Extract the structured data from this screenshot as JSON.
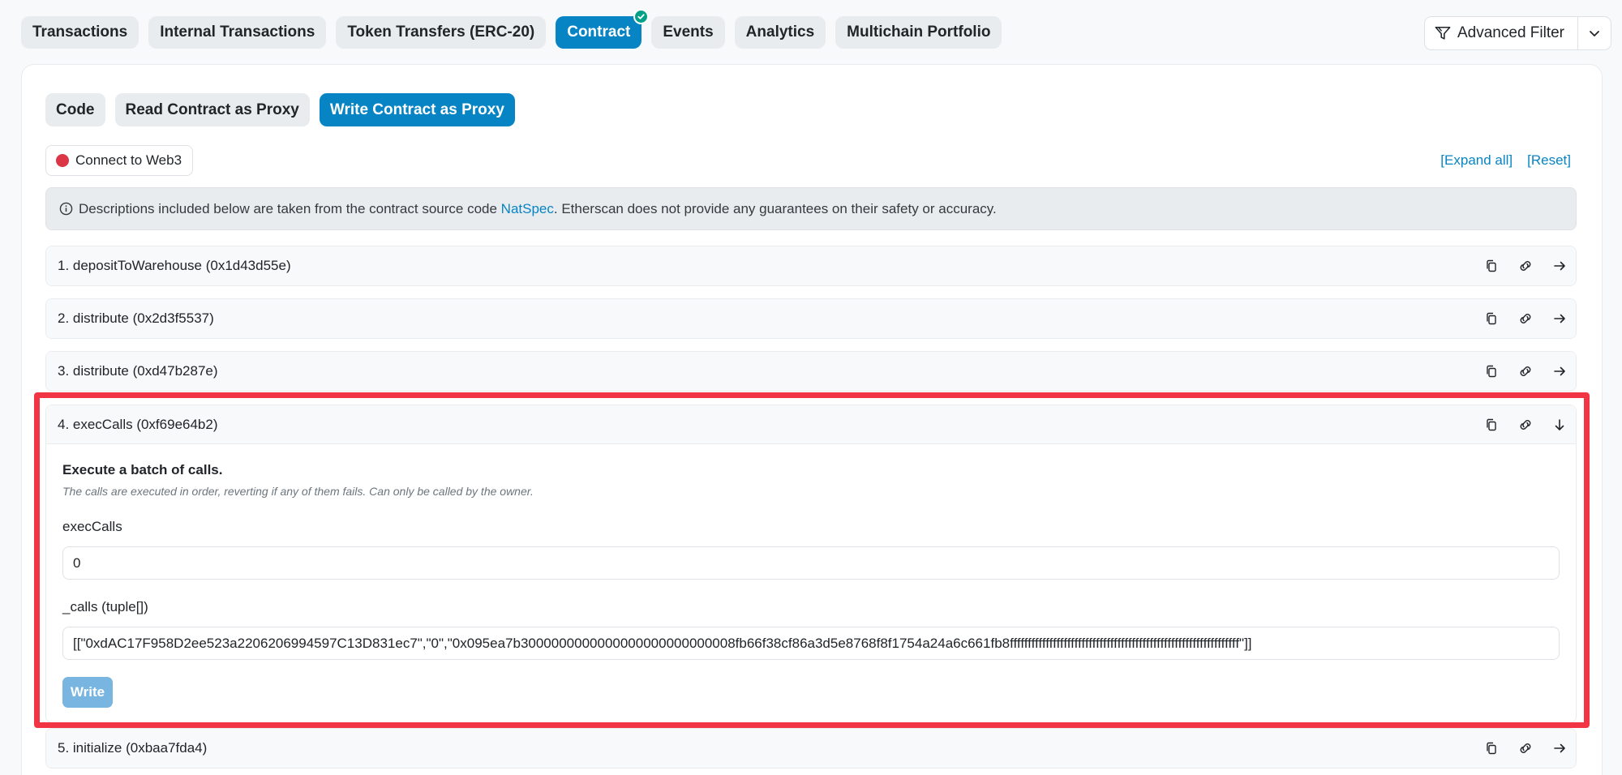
{
  "tabs": [
    {
      "label": "Transactions"
    },
    {
      "label": "Internal Transactions"
    },
    {
      "label": "Token Transfers (ERC-20)"
    },
    {
      "label": "Contract"
    },
    {
      "label": "Events"
    },
    {
      "label": "Analytics"
    },
    {
      "label": "Multichain Portfolio"
    }
  ],
  "filter": {
    "label": "Advanced Filter"
  },
  "subtabs": [
    {
      "label": "Code"
    },
    {
      "label": "Read Contract as Proxy"
    },
    {
      "label": "Write Contract as Proxy"
    }
  ],
  "connect": {
    "label": "Connect to Web3"
  },
  "links": {
    "expand": "[Expand all]",
    "reset": "[Reset]"
  },
  "notice": {
    "before": "Descriptions included below are taken from the contract source code",
    "link": "NatSpec",
    "after": ". Etherscan does not provide any guarantees on their safety or accuracy."
  },
  "methods": [
    {
      "label": "1. depositToWarehouse (0x1d43d55e)"
    },
    {
      "label": "2. distribute (0x2d3f5537)"
    },
    {
      "label": "3. distribute (0xd47b287e)"
    },
    {
      "label": "4. execCalls (0xf69e64b2)",
      "title": "Execute a batch of calls.",
      "description": "The calls are executed in order, reverting if any of them fails. Can only be called by the owner.",
      "field1_label": "execCalls",
      "field1_value": "0",
      "field2_label": "_calls (tuple[])",
      "field2_value": "[[\"0xdAC17F958D2ee523a2206206994597C13D831ec7\",\"0\",\"0x095ea7b3000000000000000000000000008fb66f38cf86a3d5e8768f8f1754a24a6c661fb8ffffffffffffffffffffffffffffffffffffffffffffffffffffffffffffffff\"]]",
      "write_label": "Write"
    },
    {
      "label": "5. initialize (0xbaa7fda4)"
    }
  ],
  "colors": {
    "accent": "#0784c3",
    "highlight": "#f13545",
    "success": "#00a186"
  }
}
